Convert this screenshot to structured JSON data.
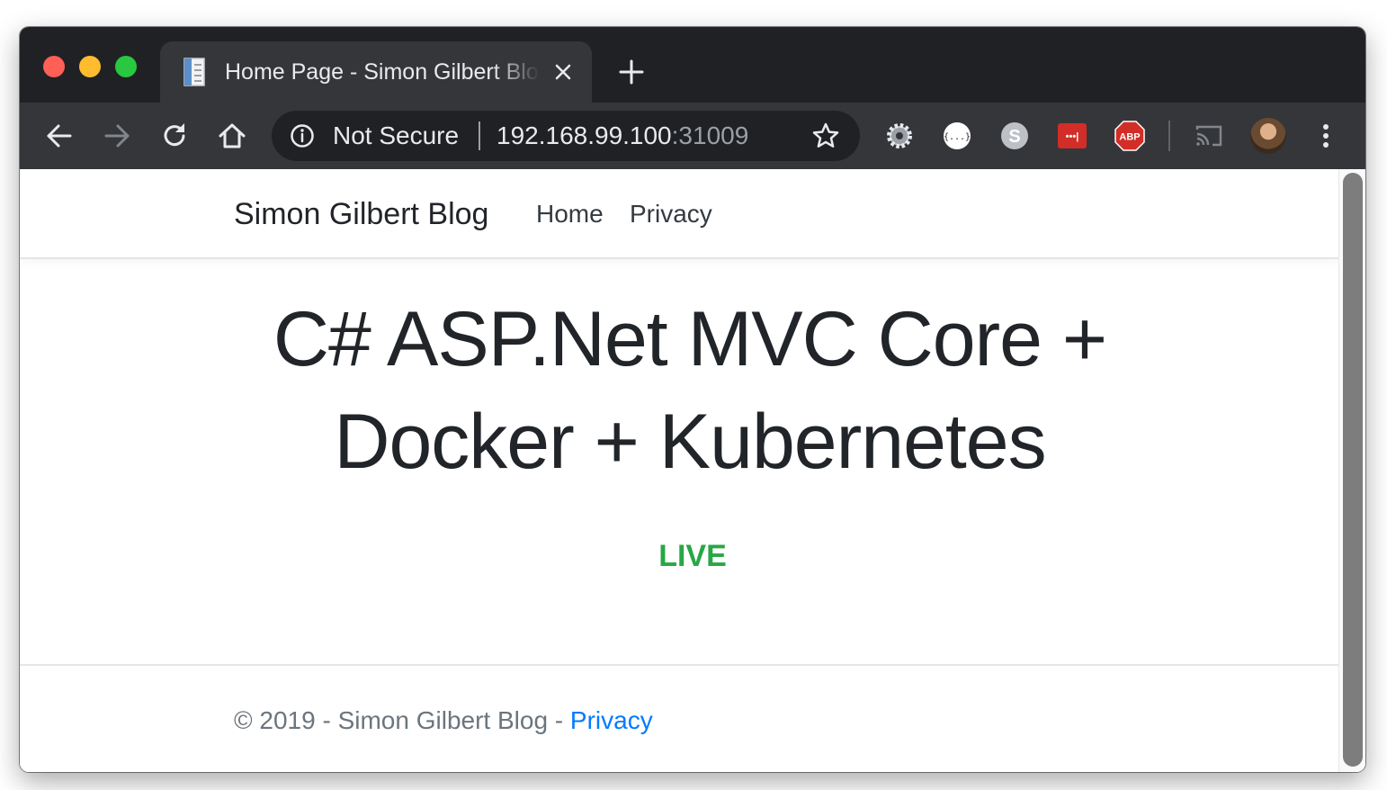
{
  "browser": {
    "tab": {
      "title": "Home Page - Simon Gilbert Blog",
      "favicon": "document-icon",
      "close_icon": "close-icon"
    },
    "new_tab_icon": "plus-icon",
    "nav_icons": [
      "back-arrow-icon",
      "forward-arrow-icon",
      "reload-icon",
      "home-icon"
    ],
    "omnibox": {
      "security_label": "Not Secure",
      "security_icon": "info-icon",
      "host": "192.168.99.100",
      "port": ":31009",
      "bookmark_icon": "star-icon"
    },
    "extensions": [
      {
        "name": "gear-extension-icon"
      },
      {
        "name": "json-formatter-extension-icon",
        "label": "{...}"
      },
      {
        "name": "skype-extension-icon",
        "label": "S"
      },
      {
        "name": "lastpass-extension-icon",
        "label": "•••|"
      },
      {
        "name": "adblock-plus-extension-icon",
        "label": "ABP"
      }
    ],
    "cast_icon": "cast-icon",
    "menu_icon": "more-vertical-icon"
  },
  "page": {
    "navbar": {
      "brand": "Simon Gilbert Blog",
      "links": [
        "Home",
        "Privacy"
      ]
    },
    "heading_line1": "C# ASP.Net MVC Core +",
    "heading_line2": "Docker + Kubernetes",
    "status": "LIVE",
    "footer": {
      "text": "© 2019 - Simon Gilbert Blog - ",
      "link": "Privacy"
    }
  },
  "colors": {
    "tabstrip": "#202124",
    "toolbar": "#35363a",
    "status_green": "#28a745",
    "link_blue": "#007bff",
    "heading": "#212529",
    "footer_text": "#6c757d"
  }
}
